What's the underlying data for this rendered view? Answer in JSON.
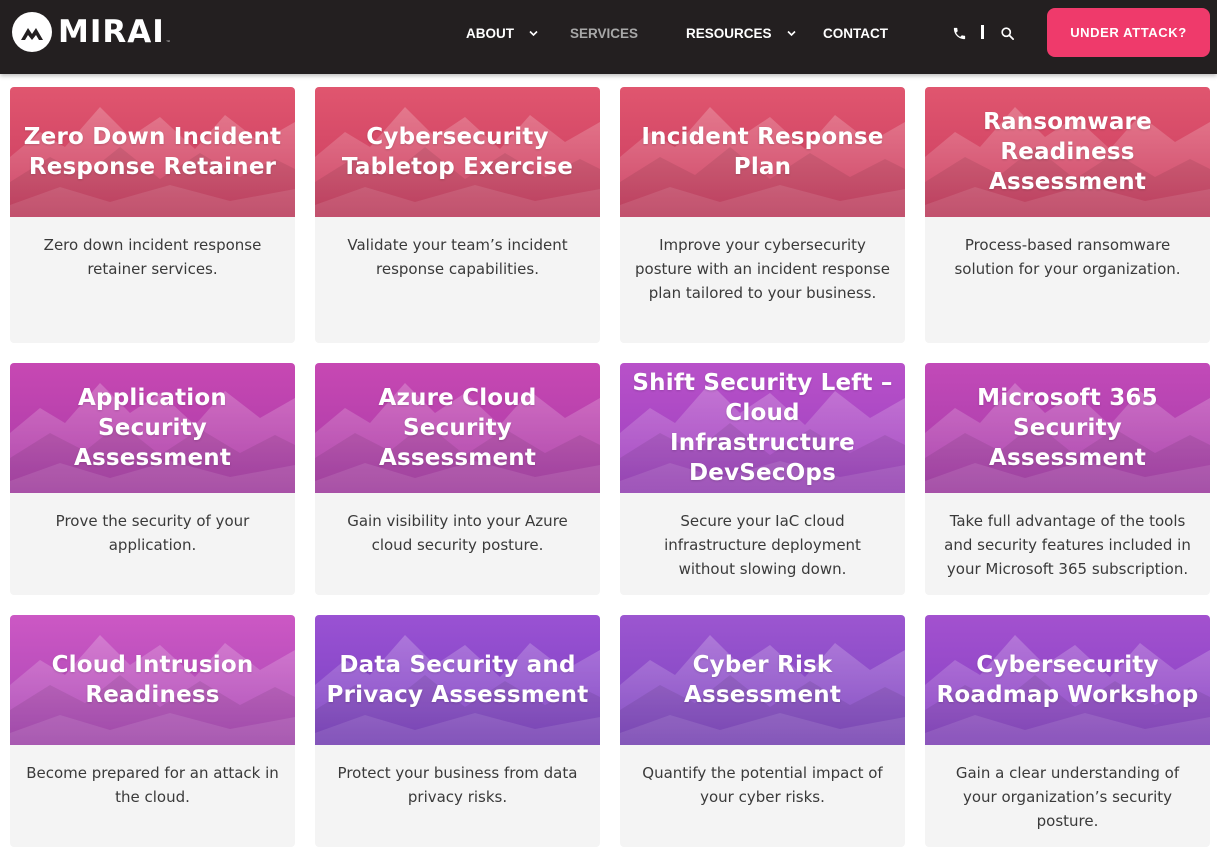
{
  "header": {
    "logo_text": "MIRAI",
    "logo_tm": "™",
    "nav": [
      {
        "label": "ABOUT",
        "has_dropdown": true
      },
      {
        "label": "SERVICES",
        "has_dropdown": false,
        "active": true
      },
      {
        "label": "RESOURCES",
        "has_dropdown": true
      },
      {
        "label": "CONTACT",
        "has_dropdown": false
      }
    ],
    "icons": [
      "phone-icon",
      "search-icon"
    ],
    "cta_label": "UNDER ATTACK?"
  },
  "colors": {
    "header_bg": "#231f20",
    "cta": "#ef3a6b",
    "card_bg": "#f4f4f4",
    "hero_row1": "#d94469",
    "hero_row2": "#b93cae",
    "hero_row3_pink": "#c44bbd",
    "hero_row3_purple": "#8b3fc9"
  },
  "cards": [
    {
      "title": "Zero Down Incident Response Retainer",
      "description": "Zero down incident response retainer services."
    },
    {
      "title": "Cybersecurity Tabletop Exercise",
      "description": "Validate your team’s incident response capabilities."
    },
    {
      "title": "Incident Response Plan",
      "description": "Improve your cybersecurity posture with an incident response plan tailored to your business."
    },
    {
      "title": "Ransomware Readiness Assessment",
      "description": "Process-based ransomware solution for your organization."
    },
    {
      "title": "Application Security Assessment",
      "description": "Prove the security of your application."
    },
    {
      "title": "Azure Cloud Security Assessment",
      "description": "Gain visibility into your Azure cloud security posture."
    },
    {
      "title": "Shift Security Left – Cloud Infrastructure DevSecOps",
      "description": "Secure your IaC cloud infrastructure deployment without slowing down."
    },
    {
      "title": "Microsoft 365 Security Assessment",
      "description": "Take full advantage of the tools and security features included in your Microsoft 365 subscription."
    },
    {
      "title": "Cloud Intrusion Readiness",
      "description": "Become prepared for an attack in the cloud."
    },
    {
      "title": "Data Security and Privacy Assessment",
      "description": "Protect your business from data privacy risks."
    },
    {
      "title": "Cyber Risk Assessment",
      "description": "Quantify the potential impact of your cyber risks."
    },
    {
      "title": "Cybersecurity Roadmap Workshop",
      "description": "Gain a clear understanding of your organization’s security posture."
    }
  ]
}
